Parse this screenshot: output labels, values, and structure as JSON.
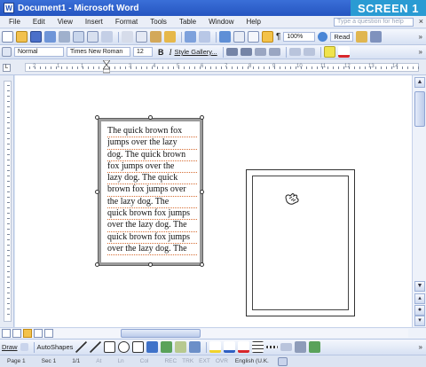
{
  "window": {
    "title": "Document1 - Microsoft Word",
    "badge": "SCREEN 1",
    "app_icon": "W"
  },
  "menu": {
    "items": [
      "File",
      "Edit",
      "View",
      "Insert",
      "Format",
      "Tools",
      "Table",
      "Window",
      "Help"
    ],
    "help_placeholder": "Type a question for help",
    "close_glyph": "×"
  },
  "toolbar": {
    "zoom": "100%",
    "read_label": "Read",
    "paragraph_mark": "¶"
  },
  "formatting": {
    "style": "Normal",
    "font": "Times New Roman",
    "size": "12",
    "bold": "B",
    "italic": "I",
    "style_gallery": "Style Gallery..."
  },
  "ruler": {
    "tab_glyph": "L",
    "numbers": [
      "2",
      "1",
      "1",
      "2",
      "3",
      "4",
      "5",
      "6",
      "7",
      "8",
      "9",
      "10",
      "11",
      "12",
      "13",
      "14"
    ]
  },
  "textbox": {
    "lines": [
      "The quick brown fox",
      "jumps over the lazy",
      "dog.  The quick brown",
      "fox jumps over the",
      "lazy dog.  The quick",
      "brown fox jumps over",
      "the lazy dog.  The",
      "quick brown fox jumps",
      "over the lazy dog.  The",
      "quick brown fox jumps",
      "over the lazy dog.  The"
    ]
  },
  "drawing": {
    "draw_label": "Draw",
    "autoshapes_label": "AutoShapes"
  },
  "status": {
    "page": "Page 1",
    "section": "Sec 1",
    "pages": "1/1",
    "at": "At",
    "ln": "Ln",
    "col": "Col",
    "rec": "REC",
    "trk": "TRK",
    "ext": "EXT",
    "ovr": "OVR",
    "language": "English (U.K."
  },
  "colors": {
    "titlebar": "#2555c0",
    "badge": "#2a9bd3",
    "selection_border": "#9b9b9b",
    "line_underline": "#d66d33"
  }
}
